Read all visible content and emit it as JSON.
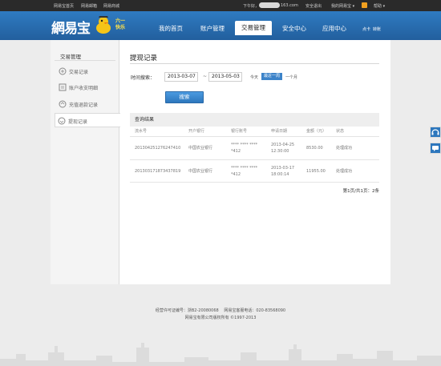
{
  "topbar": {
    "left_links": [
      "网易宝首页",
      "网易邮箱",
      "网易商城"
    ],
    "user_prefix": "下午好，",
    "user_suffix": "163.com",
    "logout": "安全退出",
    "my_wallet": "我的网易宝 ▾",
    "help": "帮助 ▾"
  },
  "header": {
    "logo_text": "網易宝",
    "promo_line1": "六一",
    "promo_line2": "快乐",
    "nav": [
      "我的首页",
      "账户管理",
      "交易管理",
      "安全中心",
      "应用中心"
    ],
    "nav_active_index": 2,
    "extra_links": [
      "点卡",
      "转账"
    ],
    "colors": {
      "header_bg": "#2a6fb1",
      "accent": "#3c83c9",
      "promo": "#ffe14a"
    }
  },
  "sidebar": {
    "title": "交易管理",
    "items": [
      {
        "label": "交易记录",
        "icon": "transaction-icon",
        "active": false
      },
      {
        "label": "账户收支明细",
        "icon": "ledger-icon",
        "active": false
      },
      {
        "label": "充值退款记录",
        "icon": "refund-icon",
        "active": false
      },
      {
        "label": "提现记录",
        "icon": "withdraw-icon",
        "active": true
      }
    ]
  },
  "main": {
    "title": "提现记录",
    "search": {
      "label": "时间搜索：",
      "start_date": "2013-03-07",
      "separator": "~",
      "end_date": "2013-05-03",
      "quick_ranges": [
        "今天",
        "最近一周",
        "一个月"
      ],
      "active_range_index": 1,
      "button_label": "搜索"
    },
    "results": {
      "heading": "查询结果",
      "columns": [
        "流水号",
        "开户银行",
        "银行账号",
        "申请日期",
        "金额（元）",
        "状态"
      ],
      "rows": [
        {
          "serial": "201304251276247410",
          "bank": "中国农业银行",
          "account_line1": "**** **** ****",
          "account_line2": "*412",
          "date_line1": "2013-04-25",
          "date_line2": "12:30:00",
          "amount": "8530.00",
          "status": "处理成功"
        },
        {
          "serial": "201303171873437819",
          "bank": "中国农业银行",
          "account_line1": "**** **** ****",
          "account_line2": "*412",
          "date_line1": "2013-03-17",
          "date_line2": "18:00:14",
          "amount": "11955.00",
          "status": "处理成功"
        }
      ],
      "pagination": "第1页/共1页：2条"
    }
  },
  "footer": {
    "line1": "经营许可证编号：浙B2-20080068 　网易宝客服电话：020-83568090",
    "line2": "网易宝有限公司版权所有 ©1997-2013"
  }
}
